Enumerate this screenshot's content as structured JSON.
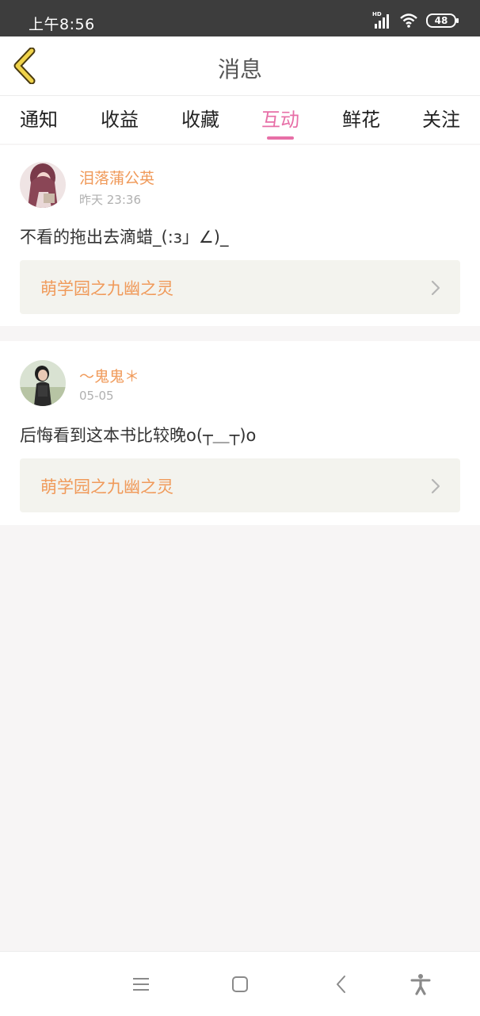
{
  "status": {
    "time": "上午8:56",
    "battery": "48",
    "network_label": "HD"
  },
  "header": {
    "title": "消息",
    "back_icon": "chevron-left-icon"
  },
  "tabs": [
    {
      "label": "通知",
      "active": false
    },
    {
      "label": "收益",
      "active": false
    },
    {
      "label": "收藏",
      "active": false
    },
    {
      "label": "互动",
      "active": true
    },
    {
      "label": "鲜花",
      "active": false
    },
    {
      "label": "关注",
      "active": false
    }
  ],
  "messages": [
    {
      "username": "泪落蒲公英",
      "date": "昨天 23:36",
      "comment": "不看的拖出去滴蜡_(:з」∠)_",
      "book": "萌学园之九幽之灵"
    },
    {
      "username": "～鬼鬼＊",
      "date": "05-05",
      "comment": "后悔看到这本书比较晚o(┬＿┬)o",
      "book": "萌学园之九幽之灵"
    }
  ],
  "colors": {
    "accent": "#e76fa7",
    "username": "#f09a5a",
    "book_bg": "#f3f3ee"
  }
}
